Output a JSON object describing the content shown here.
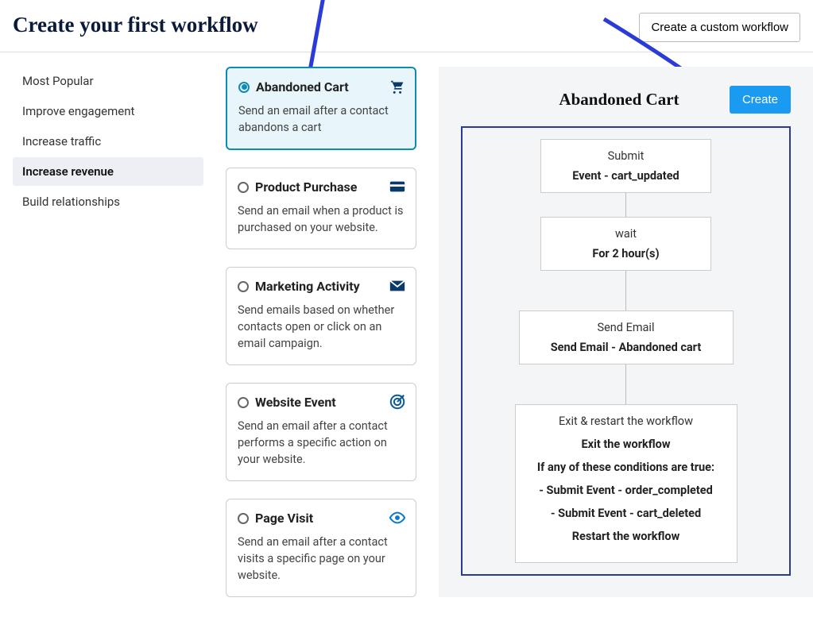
{
  "header": {
    "title": "Create your first workflow",
    "custom_button": "Create a custom workflow"
  },
  "sidebar": {
    "items": [
      {
        "label": "Most Popular",
        "active": false
      },
      {
        "label": "Improve engagement",
        "active": false
      },
      {
        "label": "Increase traffic",
        "active": false
      },
      {
        "label": "Increase revenue",
        "active": true
      },
      {
        "label": "Build relationships",
        "active": false
      }
    ]
  },
  "recipes": [
    {
      "title": "Abandoned Cart",
      "desc": "Send an email after a contact abandons a cart",
      "icon": "cart",
      "selected": true
    },
    {
      "title": "Product Purchase",
      "desc": "Send an email when a product is purchased on your website.",
      "icon": "card",
      "selected": false
    },
    {
      "title": "Marketing Activity",
      "desc": "Send emails based on whether contacts open or click on an email campaign.",
      "icon": "envelope",
      "selected": false
    },
    {
      "title": "Website Event",
      "desc": "Send an email after a contact performs a specific action on your website.",
      "icon": "bullseye",
      "selected": false
    },
    {
      "title": "Page Visit",
      "desc": "Send an email after a contact visits a specific page on your website.",
      "icon": "eye",
      "selected": false
    }
  ],
  "preview": {
    "title": "Abandoned Cart",
    "create_button": "Create",
    "steps": [
      {
        "title": "Submit",
        "main": "Event - cart_updated"
      },
      {
        "title": "wait",
        "main": "For 2 hour(s)"
      },
      {
        "title": "Send Email",
        "main": "Send Email - Abandoned cart"
      }
    ],
    "exit": {
      "title": "Exit & restart the workflow",
      "heading": "Exit the workflow",
      "cond_intro": "If any of these conditions are true:",
      "conds": [
        "- Submit Event - order_completed",
        "- Submit Event - cart_deleted"
      ],
      "restart": "Restart the workflow"
    }
  }
}
